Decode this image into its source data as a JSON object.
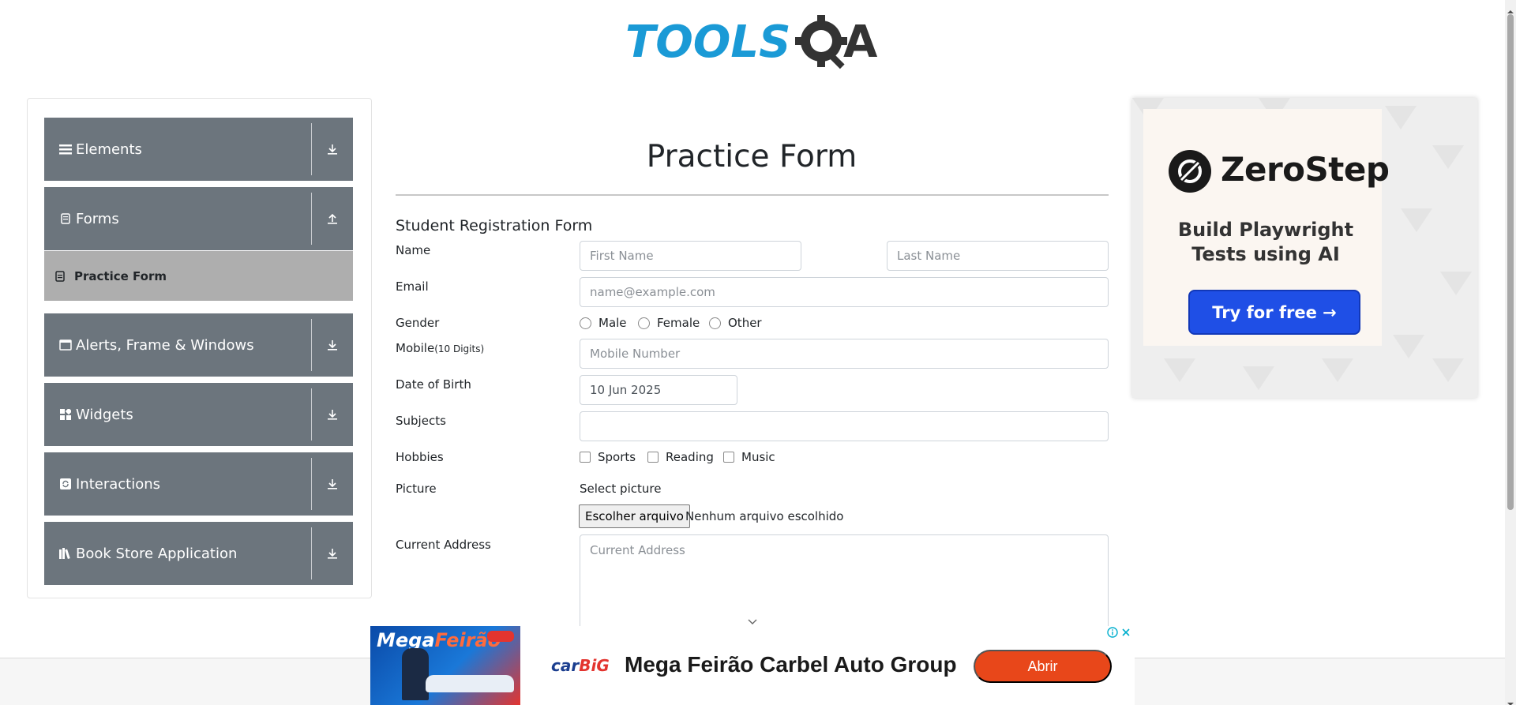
{
  "header": {
    "logo_text_left": "TOOLS",
    "logo_text_right": "A"
  },
  "sidebar": {
    "groups": [
      {
        "label": "Elements"
      },
      {
        "label": "Forms"
      },
      {
        "label": "Alerts, Frame & Windows"
      },
      {
        "label": "Widgets"
      },
      {
        "label": "Interactions"
      },
      {
        "label": "Book Store Application"
      }
    ],
    "active_item": "Practice Form"
  },
  "form": {
    "title": "Practice Form",
    "heading": "Student Registration Form",
    "labels": {
      "name": "Name",
      "email": "Email",
      "gender": "Gender",
      "mobile": "Mobile",
      "mobile_hint": "(10 Digits)",
      "dob": "Date of Birth",
      "subjects": "Subjects",
      "hobbies": "Hobbies",
      "picture": "Picture",
      "address": "Current Address"
    },
    "placeholders": {
      "first_name": "First Name",
      "last_name": "Last Name",
      "email": "name@example.com",
      "mobile": "Mobile Number",
      "address": "Current Address"
    },
    "dob_value": "10 Jun 2025",
    "gender_options": [
      "Male",
      "Female",
      "Other"
    ],
    "hobby_options": [
      "Sports",
      "Reading",
      "Music"
    ],
    "picture_caption": "Select picture",
    "file_button": "Escolher arquivo",
    "file_status": "Nenhum arquivo escolhido"
  },
  "ad_right": {
    "brand": "ZeroStep",
    "tagline": "Build Playwright Tests using AI",
    "cta": "Try for free →"
  },
  "ad_bottom": {
    "image_brand_a": "Mega",
    "image_brand_b": "Feirão",
    "logo_a": "car",
    "logo_b": "BiG",
    "title": "Mega Feirão Carbel Auto Group",
    "cta": "Abrir"
  },
  "colors": {
    "sidebar_group": "#6c757d",
    "sidebar_active": "#aeaeae",
    "ad_cta": "#1f4fe6",
    "bottom_cta": "#e8471a",
    "logo_blue": "#1a9ad6",
    "logo_dark": "#333333"
  }
}
